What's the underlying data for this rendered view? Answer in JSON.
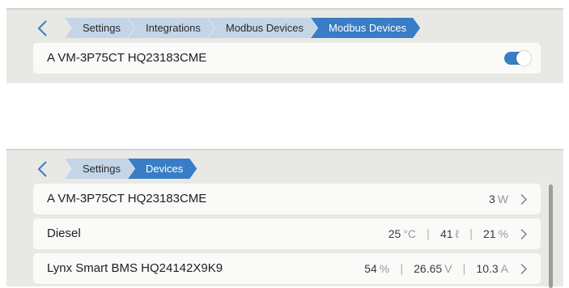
{
  "top_screen": {
    "breadcrumbs": [
      "Settings",
      "Integrations",
      "Modbus Devices",
      "Modbus Devices"
    ],
    "device": {
      "name": "A VM-3P75CT HQ23183CME",
      "enabled": true
    }
  },
  "bottom_screen": {
    "breadcrumbs": [
      "Settings",
      "Devices"
    ],
    "devices": [
      {
        "name": "A VM-3P75CT HQ23183CME",
        "v1": "3",
        "u1": "W"
      },
      {
        "name": "Diesel",
        "v1": "25",
        "u1": "°C",
        "v2": "41",
        "u2": "ℓ",
        "v3": "21",
        "u3": "%"
      },
      {
        "name": "Lynx Smart BMS HQ24142X9K9",
        "v1": "54",
        "u1": "%",
        "v2": "26.65",
        "u2": "V",
        "v3": "10.3",
        "u3": "A"
      }
    ]
  },
  "icons": {
    "back": "chevron-left-icon",
    "row": "chevron-right-icon"
  },
  "colors": {
    "accent": "#387dc5",
    "crumb": "#c3d5e6",
    "panel": "#e8e8e5",
    "row": "#fafaf8"
  }
}
